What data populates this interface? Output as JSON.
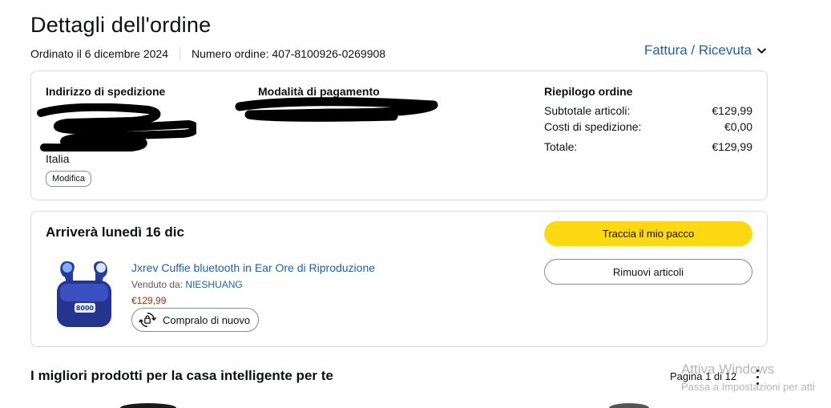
{
  "page": {
    "title": "Dettagli dell'ordine",
    "order_date": "Ordinato il 6 dicembre 2024",
    "order_number": "Numero ordine: 407-8100926-0269908",
    "invoice_link": "Fattura / Ricevuta"
  },
  "shipping": {
    "heading": "Indirizzo di spedizione",
    "country": "Italia",
    "modify_label": "Modifica"
  },
  "payment": {
    "heading": "Modalità di pagamento"
  },
  "summary": {
    "heading": "Riepilogo ordine",
    "rows": [
      {
        "label": "Subtotale articoli:",
        "value": "€129,99"
      },
      {
        "label": "Costi di spedizione:",
        "value": "€0,00"
      },
      {
        "label": "Totale:",
        "value": "€129,99"
      }
    ]
  },
  "delivery": {
    "heading": "Arriverà lunedì 16 dic",
    "track_label": "Traccia il mio pacco",
    "remove_label": "Rimuovi articoli",
    "product": {
      "title": "Jxrev Cuffie bluetooth in Ear Ore di Riproduzione",
      "seller_prefix": "Venduto da: ",
      "seller": "NIESHUANG",
      "price": "€129,99",
      "buy_again_label": "Compralo di nuovo",
      "case_display": "8000"
    }
  },
  "recommendations": {
    "heading": "I migliori prodotti per la casa intelligente per te",
    "pagination": "Pagina 1 di 12"
  },
  "watermark": {
    "line1": "Attiva Windows",
    "line2": "Passa a Impostazioni per atti"
  },
  "colors": {
    "link": "#2162a1",
    "primary_button": "#ffd814",
    "price": "#b12704",
    "border": "#d5d9d9"
  }
}
